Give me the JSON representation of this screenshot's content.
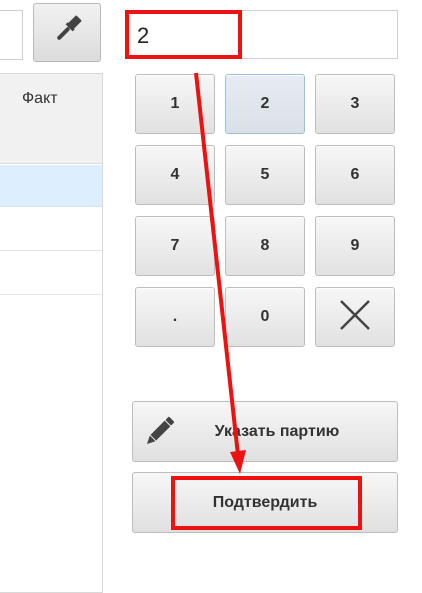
{
  "table": {
    "column_header": "Факт"
  },
  "quantity": {
    "value": "2"
  },
  "keypad": {
    "keys": [
      "1",
      "2",
      "3",
      "4",
      "5",
      "6",
      "7",
      "8",
      "9",
      ".",
      "0"
    ],
    "clear_key_icon": "close-icon"
  },
  "actions": {
    "batch_label": "Указать партию",
    "batch_icon": "pencil-icon",
    "confirm_label": "Подтвердить"
  },
  "toolbar": {
    "brush_icon": "paintbrush-icon"
  },
  "annotation": {
    "color": "#ee1111"
  }
}
